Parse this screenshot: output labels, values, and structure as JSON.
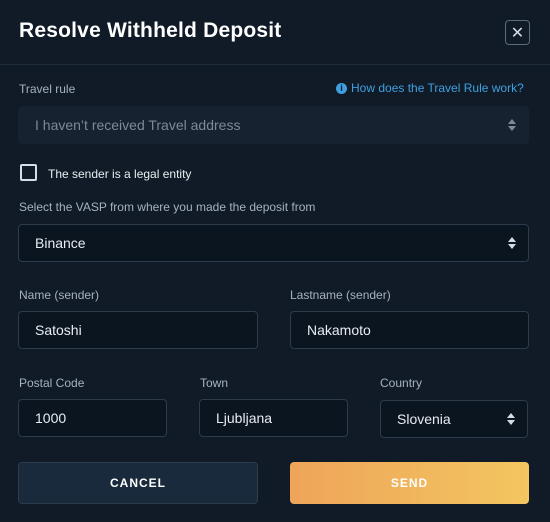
{
  "modal": {
    "title": "Resolve Withheld Deposit",
    "close_label": "✕"
  },
  "travel_rule": {
    "label": "Travel rule",
    "help_link": "How does the Travel Rule work?",
    "selected": "I haven’t received Travel address"
  },
  "legal_entity": {
    "label": "The sender is a legal entity",
    "checked": false
  },
  "vasp": {
    "label": "Select the VASP from where you made the deposit from",
    "selected": "Binance"
  },
  "sender": {
    "name_label": "Name (sender)",
    "name_value": "Satoshi",
    "lastname_label": "Lastname (sender)",
    "lastname_value": "Nakamoto"
  },
  "address": {
    "postal_label": "Postal Code",
    "postal_value": "1000",
    "town_label": "Town",
    "town_value": "Ljubljana",
    "country_label": "Country",
    "country_selected": "Slovenia"
  },
  "actions": {
    "cancel_label": "CANCEL",
    "send_label": "SEND"
  },
  "colors": {
    "background": "#101b27",
    "link": "#3ea0e0",
    "send_gradient_start": "#eea45a",
    "send_gradient_end": "#f3c65f"
  }
}
